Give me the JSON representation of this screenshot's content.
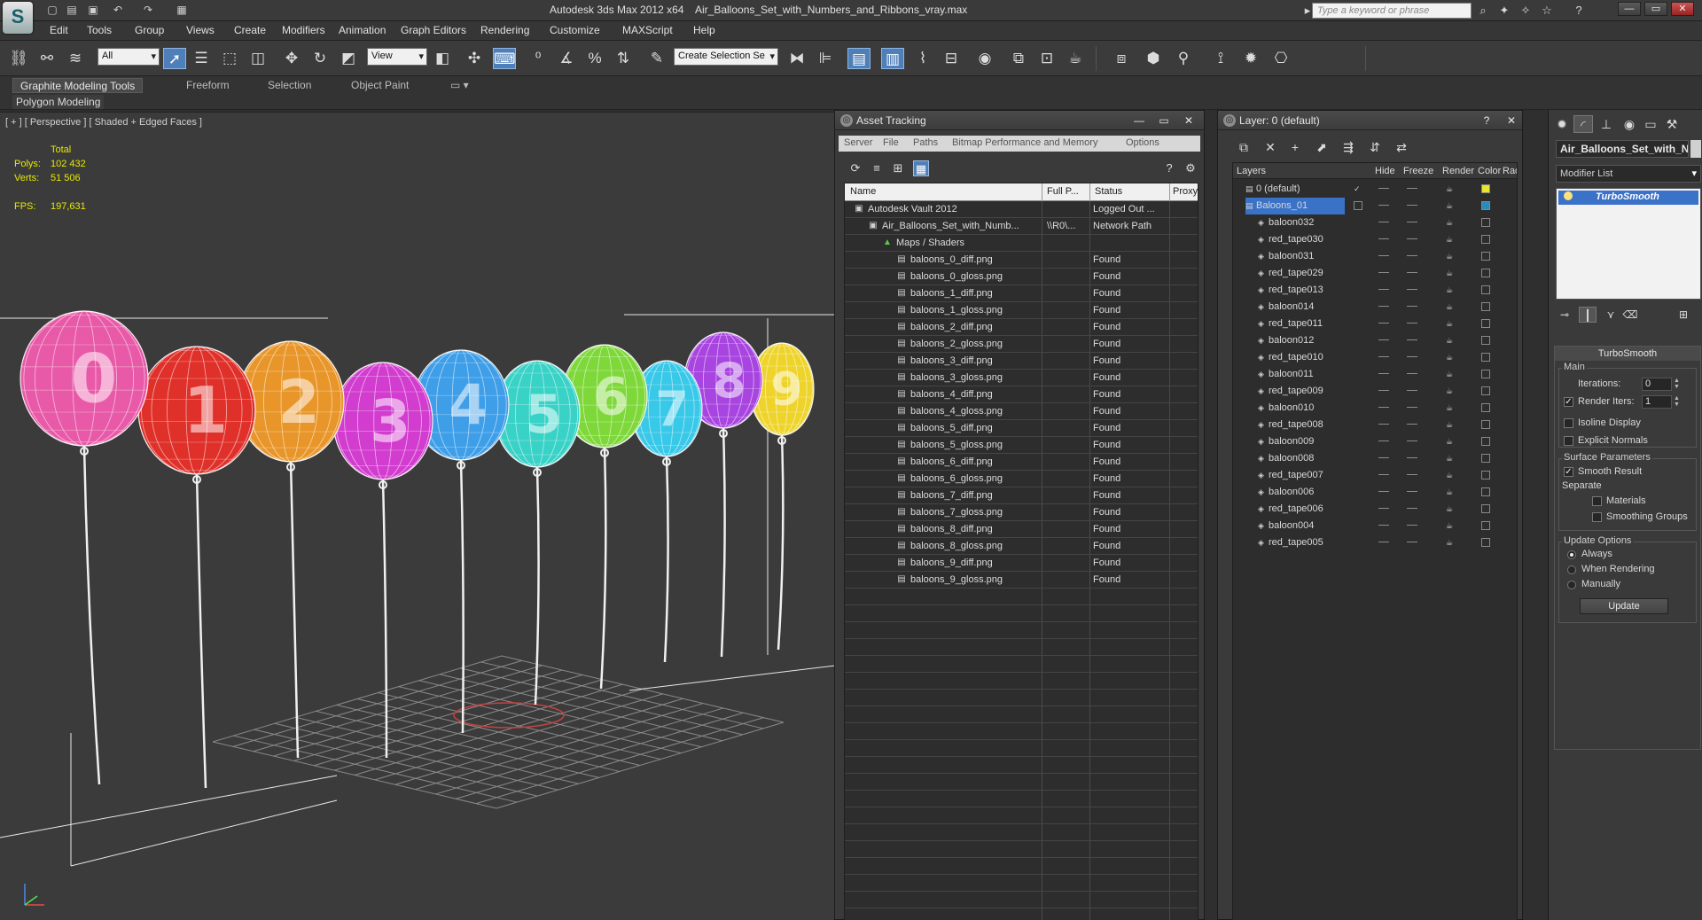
{
  "titlebar": {
    "app_title": "Autodesk 3ds Max 2012 x64",
    "file_title": "Air_Balloons_Set_with_Numbers_and_Ribbons_vray.max",
    "search_placeholder": "Type a keyword or phrase",
    "logo_glyph": "S"
  },
  "menu": [
    "Edit",
    "Tools",
    "Group",
    "Views",
    "Create",
    "Modifiers",
    "Animation",
    "Graph Editors",
    "Rendering",
    "Customize",
    "MAXScript",
    "Help"
  ],
  "toolbar": {
    "selection_filter": "All",
    "reference_coord": "View",
    "named_selection": "Create Selection Se",
    "color_label": "color247"
  },
  "ribbon": {
    "tabs": [
      "Graphite Modeling Tools",
      "Freeform",
      "Selection",
      "Object Paint"
    ],
    "sub_tab": "Polygon Modeling"
  },
  "viewport": {
    "label": "[ + ] [ Perspective ] [ Shaded + Edged Faces ]",
    "stats_header": "Total",
    "polys_label": "Polys:",
    "polys_value": "102 432",
    "verts_label": "Verts:",
    "verts_value": "51 506",
    "fps_label": "FPS:",
    "fps_value": "197,631",
    "balloons": [
      {
        "digit": "0",
        "color": "#e85aa8"
      },
      {
        "digit": "1",
        "color": "#e0302a"
      },
      {
        "digit": "2",
        "color": "#e8962a"
      },
      {
        "digit": "3",
        "color": "#d23ccf"
      },
      {
        "digit": "4",
        "color": "#3e9ee8"
      },
      {
        "digit": "5",
        "color": "#38d2c6"
      },
      {
        "digit": "6",
        "color": "#7ed83a"
      },
      {
        "digit": "7",
        "color": "#38c8e8"
      },
      {
        "digit": "8",
        "color": "#a844e0"
      },
      {
        "digit": "9",
        "color": "#eed42a"
      }
    ]
  },
  "asset_tracking": {
    "title": "Asset Tracking",
    "menu": [
      "Server",
      "File",
      "Paths",
      "Bitmap Performance and Memory",
      "Options"
    ],
    "columns": [
      "Name",
      "Full P...",
      "Status",
      "Proxy R"
    ],
    "rows": [
      {
        "name": "Autodesk Vault 2012",
        "full": "",
        "status": "Logged Out ..."
      },
      {
        "name": "Air_Balloons_Set_with_Numb...",
        "full": "\\\\R0\\...",
        "status": "Network Path"
      },
      {
        "name": "Maps / Shaders",
        "full": "",
        "status": ""
      },
      {
        "name": "baloons_0_diff.png",
        "full": "",
        "status": "Found"
      },
      {
        "name": "baloons_0_gloss.png",
        "full": "",
        "status": "Found"
      },
      {
        "name": "baloons_1_diff.png",
        "full": "",
        "status": "Found"
      },
      {
        "name": "baloons_1_gloss.png",
        "full": "",
        "status": "Found"
      },
      {
        "name": "baloons_2_diff.png",
        "full": "",
        "status": "Found"
      },
      {
        "name": "baloons_2_gloss.png",
        "full": "",
        "status": "Found"
      },
      {
        "name": "baloons_3_diff.png",
        "full": "",
        "status": "Found"
      },
      {
        "name": "baloons_3_gloss.png",
        "full": "",
        "status": "Found"
      },
      {
        "name": "baloons_4_diff.png",
        "full": "",
        "status": "Found"
      },
      {
        "name": "baloons_4_gloss.png",
        "full": "",
        "status": "Found"
      },
      {
        "name": "baloons_5_diff.png",
        "full": "",
        "status": "Found"
      },
      {
        "name": "baloons_5_gloss.png",
        "full": "",
        "status": "Found"
      },
      {
        "name": "baloons_6_diff.png",
        "full": "",
        "status": "Found"
      },
      {
        "name": "baloons_6_gloss.png",
        "full": "",
        "status": "Found"
      },
      {
        "name": "baloons_7_diff.png",
        "full": "",
        "status": "Found"
      },
      {
        "name": "baloons_7_gloss.png",
        "full": "",
        "status": "Found"
      },
      {
        "name": "baloons_8_diff.png",
        "full": "",
        "status": "Found"
      },
      {
        "name": "baloons_8_gloss.png",
        "full": "",
        "status": "Found"
      },
      {
        "name": "baloons_9_diff.png",
        "full": "",
        "status": "Found"
      },
      {
        "name": "baloons_9_gloss.png",
        "full": "",
        "status": "Found"
      }
    ]
  },
  "layer_manager": {
    "title": "Layer: 0 (default)",
    "columns": [
      "Layers",
      "Hide",
      "Freeze",
      "Render",
      "Color",
      "Rad"
    ],
    "rows": [
      {
        "name": "0 (default)",
        "swatch": "#e8e828"
      },
      {
        "name": "Baloons_01",
        "swatch": "#2a8ab8"
      },
      {
        "name": "baloon032",
        "swatch": ""
      },
      {
        "name": "red_tape030",
        "swatch": ""
      },
      {
        "name": "baloon031",
        "swatch": ""
      },
      {
        "name": "red_tape029",
        "swatch": ""
      },
      {
        "name": "red_tape013",
        "swatch": ""
      },
      {
        "name": "baloon014",
        "swatch": ""
      },
      {
        "name": "red_tape011",
        "swatch": ""
      },
      {
        "name": "baloon012",
        "swatch": ""
      },
      {
        "name": "red_tape010",
        "swatch": ""
      },
      {
        "name": "baloon011",
        "swatch": ""
      },
      {
        "name": "red_tape009",
        "swatch": ""
      },
      {
        "name": "baloon010",
        "swatch": ""
      },
      {
        "name": "red_tape008",
        "swatch": ""
      },
      {
        "name": "baloon009",
        "swatch": ""
      },
      {
        "name": "baloon008",
        "swatch": ""
      },
      {
        "name": "red_tape007",
        "swatch": ""
      },
      {
        "name": "baloon006",
        "swatch": ""
      },
      {
        "name": "red_tape006",
        "swatch": ""
      },
      {
        "name": "baloon004",
        "swatch": ""
      },
      {
        "name": "red_tape005",
        "swatch": ""
      }
    ]
  },
  "command_panel": {
    "object_name": "Air_Balloons_Set_with_N",
    "modifier_list": "Modifier List",
    "stack_item": "TurboSmooth",
    "rollout_title": "TurboSmooth",
    "main_group": "Main",
    "iterations_label": "Iterations:",
    "iterations_value": "0",
    "render_iters_label": "Render Iters:",
    "render_iters_value": "1",
    "isoline_label": "Isoline Display",
    "explicit_normals_label": "Explicit Normals",
    "surface_group": "Surface Parameters",
    "smooth_result_label": "Smooth Result",
    "separate_label": "Separate",
    "materials_label": "Materials",
    "smoothing_groups_label": "Smoothing Groups",
    "update_group": "Update Options",
    "always_label": "Always",
    "when_rendering_label": "When Rendering",
    "manually_label": "Manually",
    "update_button": "Update"
  }
}
